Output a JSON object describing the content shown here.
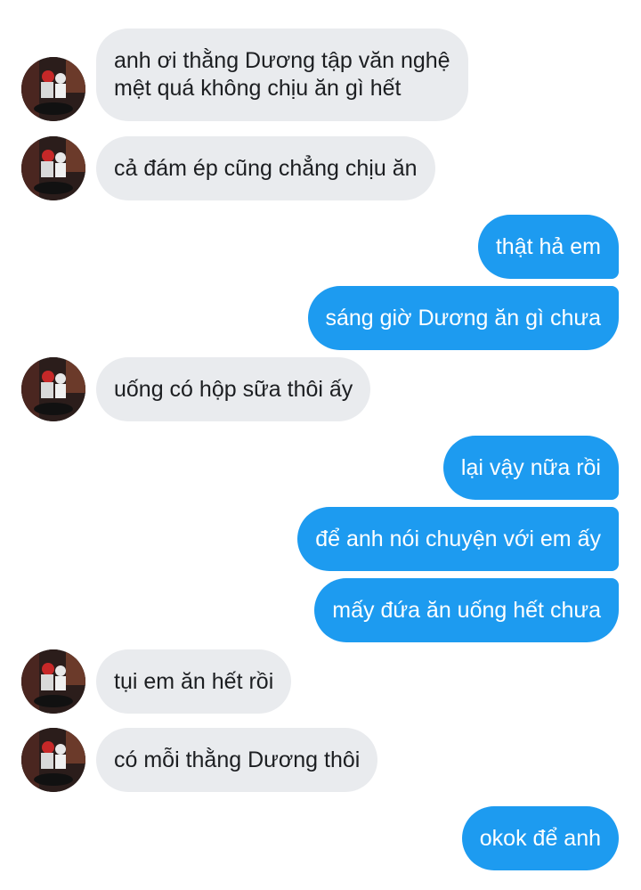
{
  "messages": [
    {
      "side": "in",
      "lines": [
        "anh ơi thằng Dương tập văn nghệ",
        "mệt quá không chịu ăn gì hết"
      ],
      "avatar": "contact-avatar"
    },
    {
      "side": "in",
      "lines": [
        "cả đám ép cũng chẳng chịu ăn"
      ],
      "avatar": "contact-avatar"
    },
    {
      "side": "out",
      "lines": [
        "thật hả em"
      ]
    },
    {
      "side": "out",
      "lines": [
        "sáng giờ Dương ăn gì chưa"
      ]
    },
    {
      "side": "in",
      "lines": [
        "uống có hộp sữa thôi ấy"
      ],
      "avatar": "contact-avatar"
    },
    {
      "side": "out",
      "lines": [
        "lại vậy nữa rồi"
      ]
    },
    {
      "side": "out",
      "lines": [
        "để anh nói chuyện với em ấy"
      ]
    },
    {
      "side": "out",
      "lines": [
        "mấy đứa ăn uống hết chưa"
      ]
    },
    {
      "side": "in",
      "lines": [
        "tụi em ăn hết rồi"
      ],
      "avatar": "contact-avatar"
    },
    {
      "side": "in",
      "lines": [
        "có mỗi thằng Dương thôi"
      ],
      "avatar": "contact-avatar"
    },
    {
      "side": "out",
      "lines": [
        "okok để anh"
      ]
    }
  ],
  "colors": {
    "incoming_bubble": "#e9ebee",
    "incoming_text": "#1c1e21",
    "outgoing_bubble": "#1d9bf0",
    "outgoing_text": "#ffffff"
  }
}
